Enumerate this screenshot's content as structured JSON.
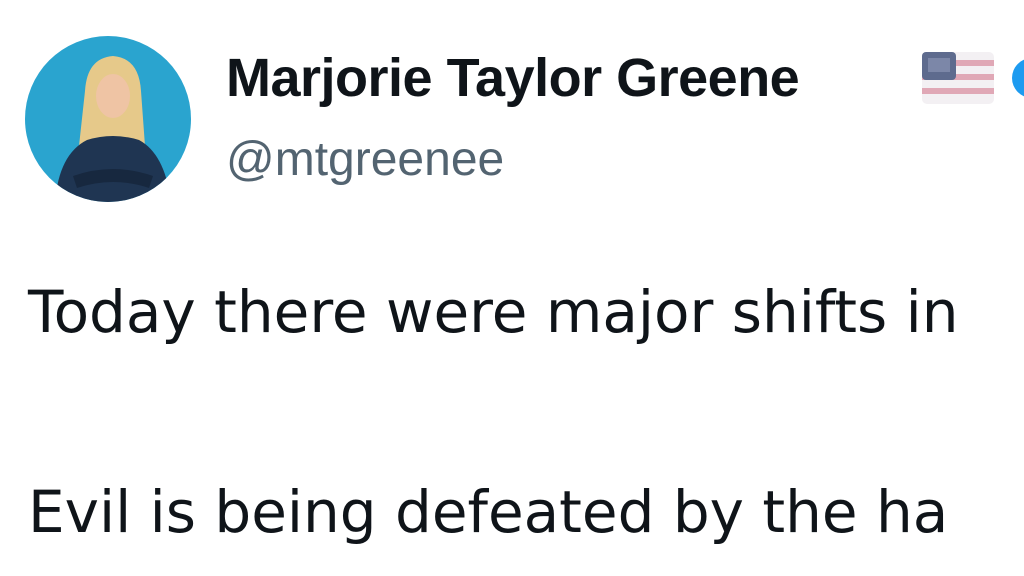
{
  "author": {
    "display_name": "Marjorie Taylor Greene",
    "handle": "@mtgreenee",
    "flag_icon": "us-flag-icon",
    "badge_icon": "verified-badge-icon",
    "badge_color": "#1d9bf0",
    "avatar_background": "#2aa4cf"
  },
  "tweet": {
    "lines": [
      "Today there were major shifts in",
      "Evil is being defeated by the ha"
    ]
  }
}
